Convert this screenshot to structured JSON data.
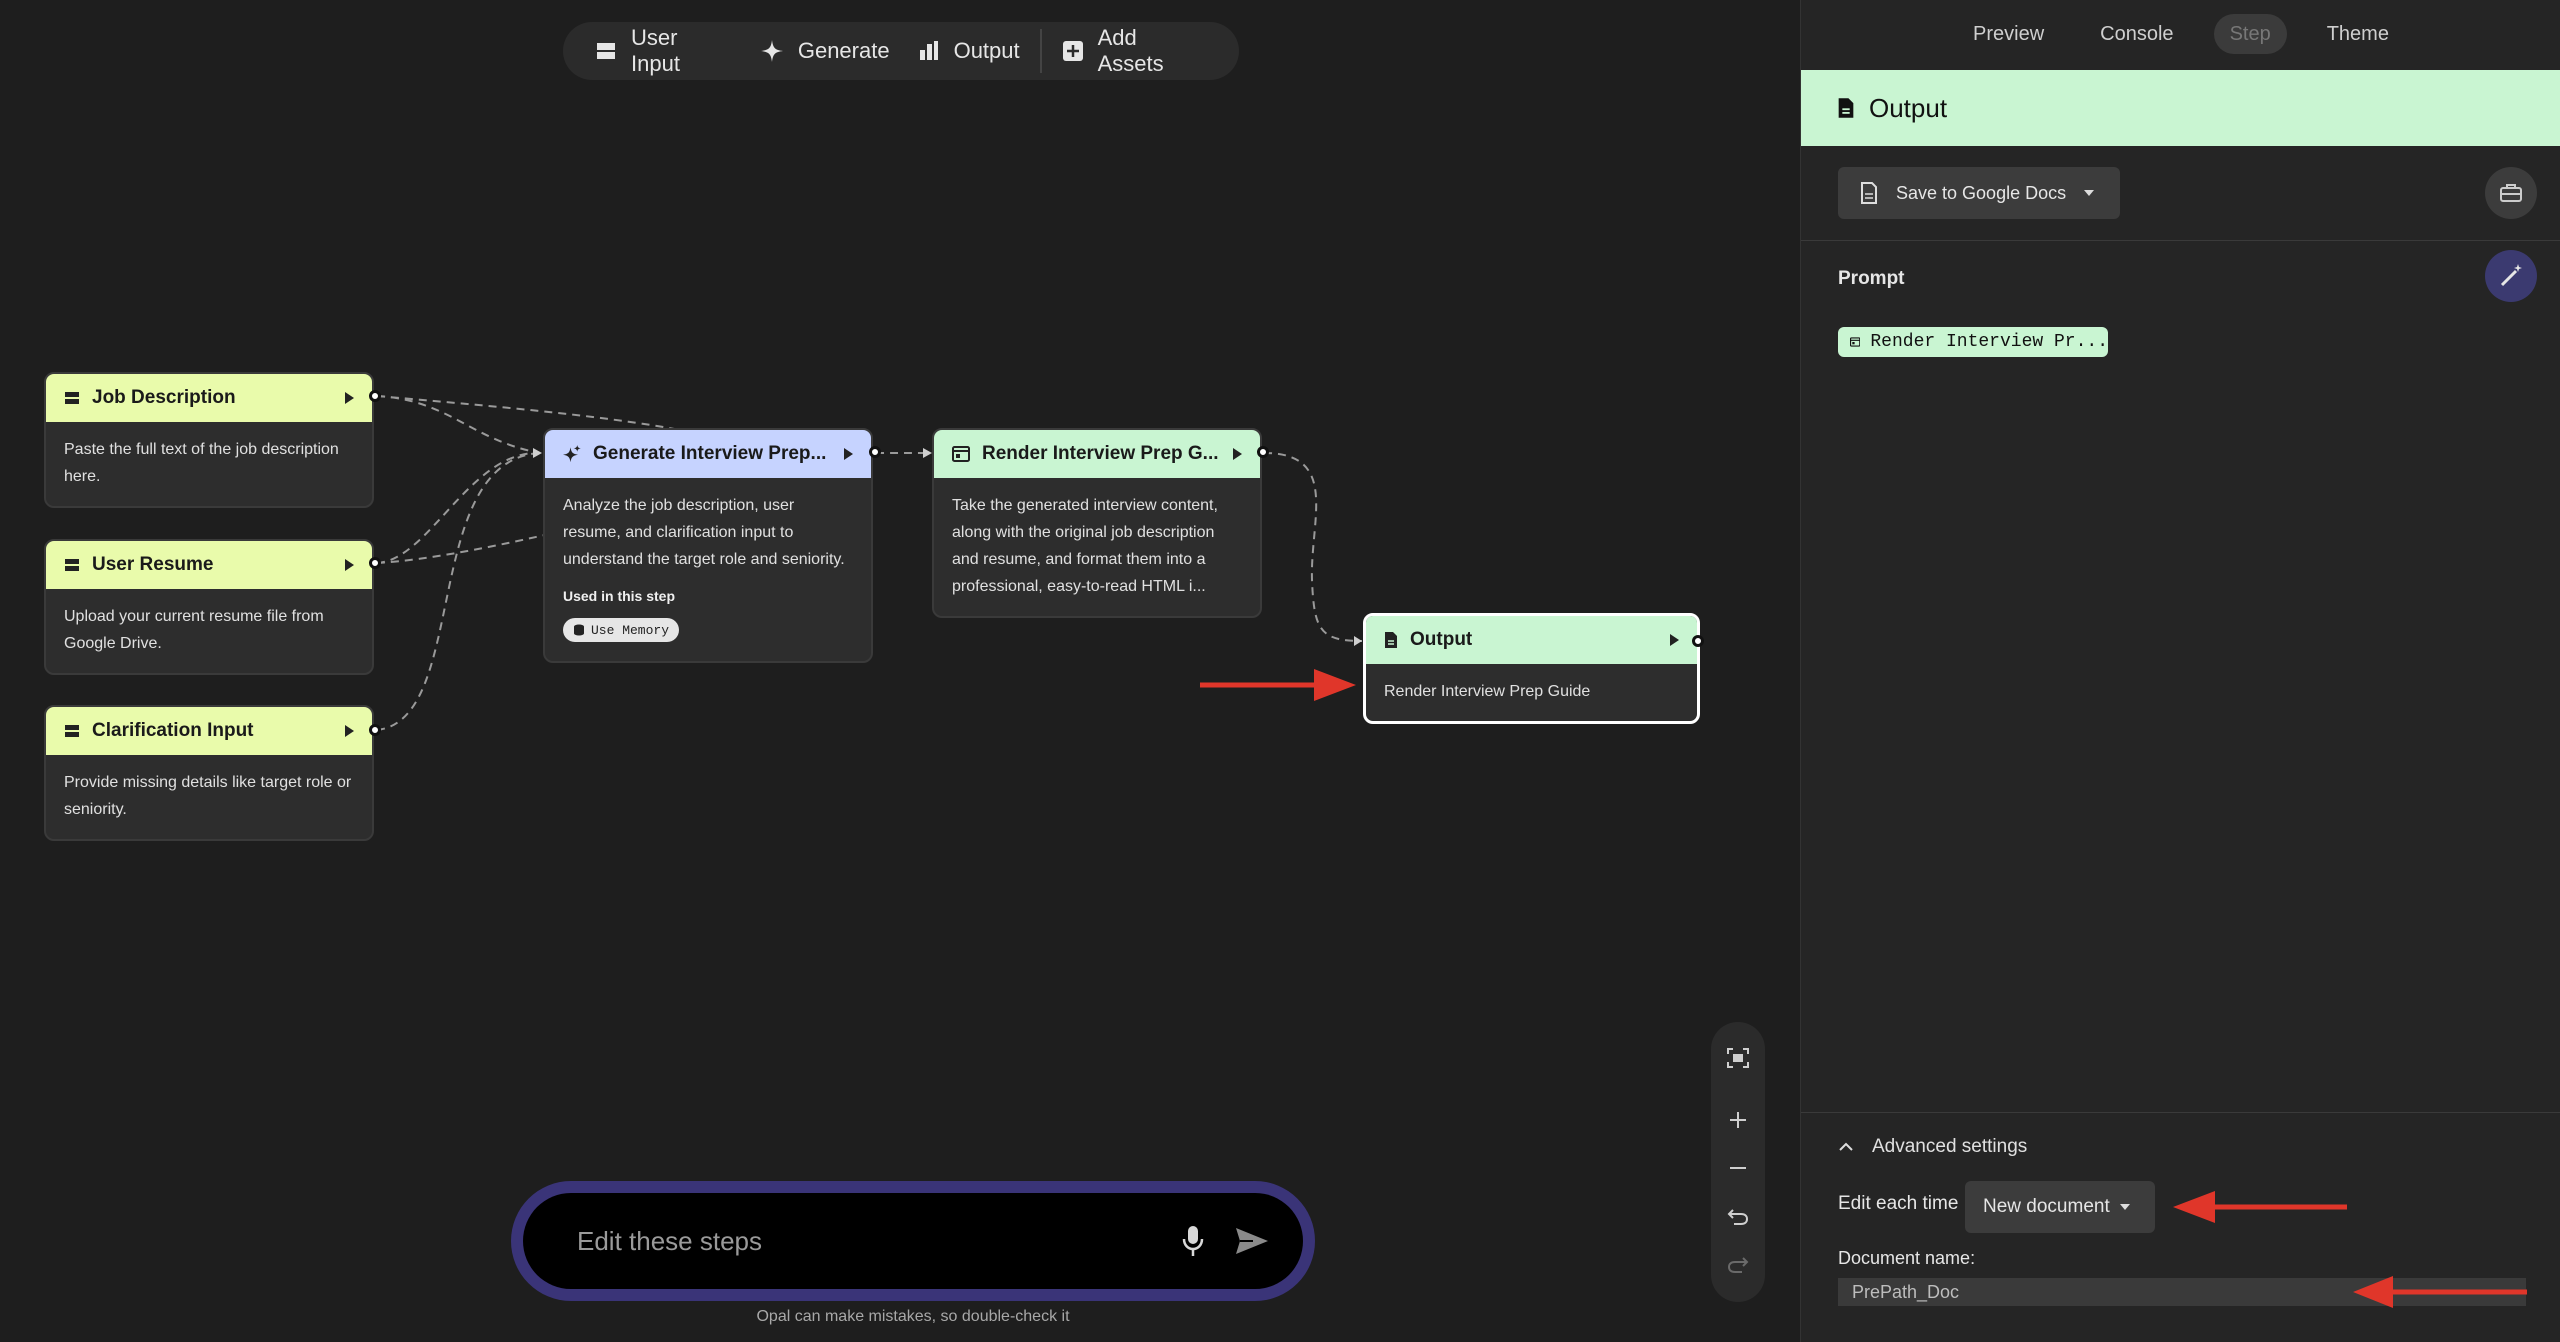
{
  "toolbar": {
    "user_input": "User Input",
    "generate": "Generate",
    "output": "Output",
    "add_assets": "Add Assets"
  },
  "nodes": {
    "job_description": {
      "title": "Job Description",
      "body": "Paste the full text of the job description here."
    },
    "user_resume": {
      "title": "User Resume",
      "body": "Upload your current resume file from Google Drive."
    },
    "clarification": {
      "title": "Clarification Input",
      "body": "Provide missing details like target role or seniority."
    },
    "generate": {
      "title": "Generate Interview Prep...",
      "body": "Analyze the job description, user resume, and clarification input to understand the target role and seniority.",
      "used_label": "Used in this step",
      "chip": "Use Memory"
    },
    "render": {
      "title": "Render Interview Prep G...",
      "body": "Take the generated interview content, along with the original job description and resume, and format them into a professional, easy-to-read HTML i..."
    },
    "output": {
      "title": "Output",
      "body": "Render Interview Prep Guide"
    }
  },
  "chat": {
    "placeholder": "Edit these steps",
    "disclaimer": "Opal can make mistakes, so double-check it"
  },
  "panel": {
    "tabs": [
      "Preview",
      "Console",
      "Step",
      "Theme"
    ],
    "active_tab": "Step",
    "header_title": "Output",
    "save_button": "Save to Google Docs",
    "prompt_label": "Prompt",
    "prompt_chip": "Render Interview Pr...",
    "advanced_label": "Advanced settings",
    "edit_label": "Edit each time",
    "edit_value": "New document",
    "docname_label": "Document name:",
    "docname_value": "PrePath_Doc"
  },
  "colors": {
    "input_node": "#e9fbab",
    "generate_node": "#c6d3ff",
    "output_node": "#c9f5d2",
    "annotation_arrow": "#e0362a",
    "chat_ring": "#3a3478"
  }
}
